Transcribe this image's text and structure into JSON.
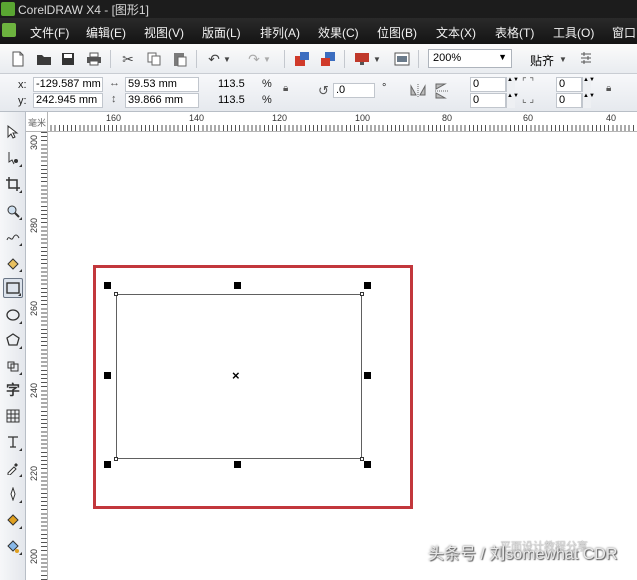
{
  "window": {
    "title": "CorelDRAW X4 - [图形1]"
  },
  "menu": [
    "文件(F)",
    "编辑(E)",
    "视图(V)",
    "版面(L)",
    "排列(A)",
    "效果(C)",
    "位图(B)",
    "文本(X)",
    "表格(T)",
    "工具(O)",
    "窗口"
  ],
  "toolbar": {
    "zoom": "200%",
    "snap_label": "贴齐",
    "icons": [
      "new-icon",
      "open-icon",
      "save-icon",
      "print-icon",
      "cut-icon",
      "copy-icon",
      "paste-icon",
      "undo-icon",
      "redo-icon",
      "import-icon",
      "export-icon",
      "application-launcher-icon",
      "welcome-screen-icon",
      "options-icon"
    ]
  },
  "property_bar": {
    "x_label": "x:",
    "x_value": "-129.587 mm",
    "y_label": "y:",
    "y_value": "242.945 mm",
    "width_value": "59.53 mm",
    "height_value": "39.866 mm",
    "scale_x": "113.5",
    "scale_y": "113.5",
    "percent": "%",
    "rotation": ".0",
    "degree": "°",
    "corner_tl": "0",
    "corner_bl": "0",
    "corner_tr": "0",
    "corner_br": "0"
  },
  "ruler": {
    "h_labels": [
      "160",
      "140",
      "120",
      "100",
      "80",
      "60",
      "40"
    ],
    "v_labels": [
      "300",
      "280",
      "260",
      "240",
      "220",
      "200"
    ],
    "corner": "毫米"
  },
  "toolbox": [
    "pick-tool-icon",
    "shape-tool-icon",
    "crop-tool-icon",
    "zoom-tool-icon",
    "freehand-tool-icon",
    "smart-fill-tool-icon",
    "rectangle-tool-icon",
    "ellipse-tool-icon",
    "polygon-tool-icon",
    "basic-shapes-tool-icon",
    "text-tool-icon",
    "table-tool-icon",
    "dimension-tool-icon",
    "eyedropper-tool-icon",
    "outline-tool-icon",
    "fill-tool-icon",
    "interactive-fill-tool-icon"
  ],
  "toolbox_text": {
    "text_tool": "字"
  },
  "watermark": {
    "line1": "平面设计教程分享",
    "line2": "头条号 / 刘somewhat CDR"
  },
  "colors": {
    "highlight": "#c2373c",
    "menubar": "#141414"
  }
}
